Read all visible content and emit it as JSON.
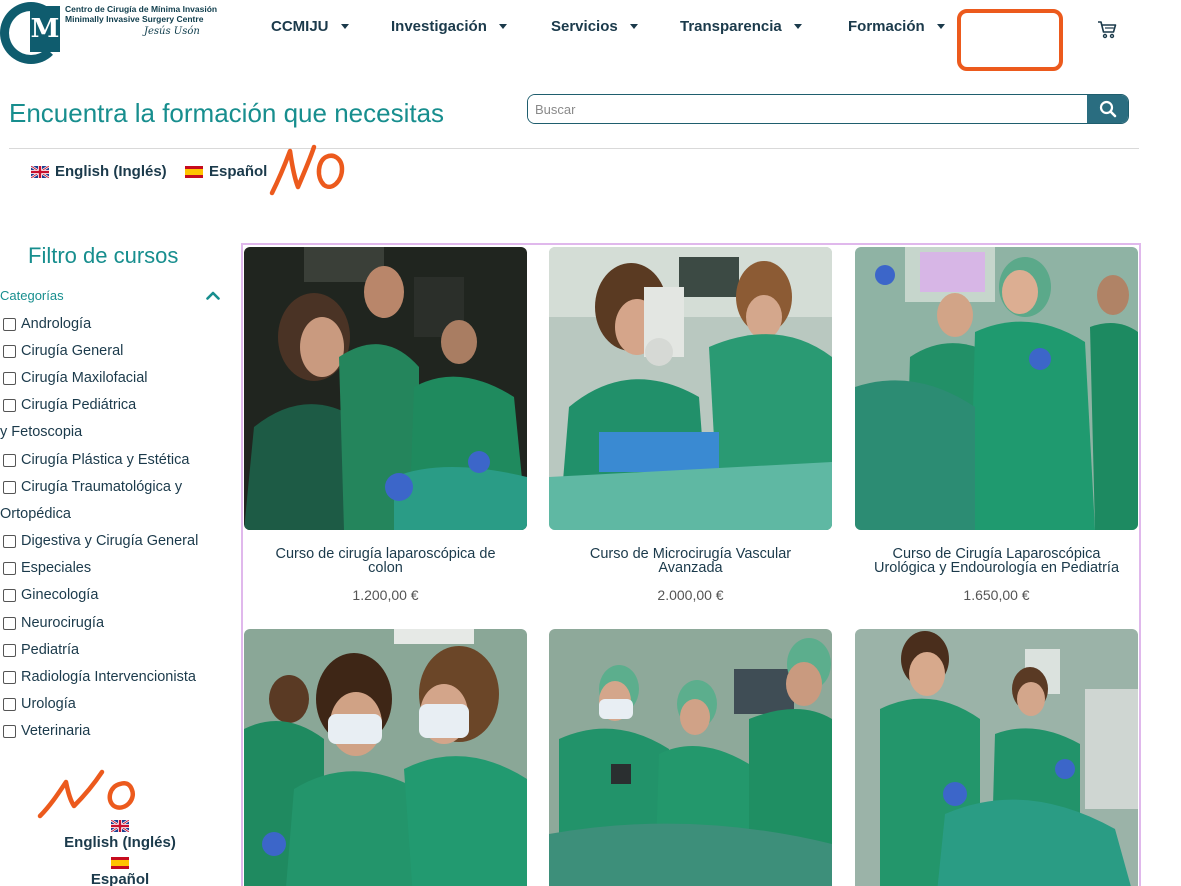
{
  "logo": {
    "line1": "Centro de Cirugía de Mínima Invasión",
    "line2": "Minimally Invasive Surgery Centre",
    "line3": "Jesús Usón",
    "mark": "M"
  },
  "nav": {
    "items": [
      {
        "label": "CCMIJU",
        "icon": "caret-down-icon"
      },
      {
        "label": "Investigación",
        "icon": "caret-down-icon"
      },
      {
        "label": "Servicios",
        "icon": "caret-down-icon"
      },
      {
        "label": "Transparencia",
        "icon": "caret-down-icon"
      },
      {
        "label": "Formación",
        "icon": "caret-down-icon"
      }
    ],
    "cart_icon": "cart-icon"
  },
  "hero": {
    "title": "Encuentra la formación que necesitas"
  },
  "search": {
    "placeholder": "Buscar",
    "value": "",
    "button_icon": "search-icon"
  },
  "languages_top": [
    {
      "label": "English (Inglés)",
      "flag": "uk-flag-icon"
    },
    {
      "label": "Español",
      "flag": "spain-flag-icon"
    }
  ],
  "annotations": {
    "top_note": "NO",
    "bottom_note": "NO",
    "color": "#ec5a1d"
  },
  "sidebar": {
    "title": "Filtro de cursos",
    "category_header": "Categorías",
    "categories": [
      "Andrología",
      "Cirugía General",
      "Cirugía Maxilofacial",
      "Cirugía Pediátrica y Fetoscopia",
      "Cirugía Plástica y Estética",
      "Cirugía Traumatológica y Ortopédica",
      "Digestiva y Cirugía General",
      "Especiales",
      "Ginecología",
      "Neurocirugía",
      "Pediatría",
      "Radiología Intervencionista",
      "Urología",
      "Veterinaria"
    ],
    "category_wraps": {
      "cat3_line1": "Cirugía Pediátrica",
      "cat3_line2": "y Fetoscopia",
      "cat5_line1": "Cirugía Traumatológica y",
      "cat5_line2": "Ortopédica"
    }
  },
  "languages_bottom": [
    {
      "label": "English (Inglés)",
      "flag": "uk-flag-icon"
    },
    {
      "label": "Español",
      "flag": "spain-flag-icon"
    }
  ],
  "products": [
    {
      "title": "Curso de cirugía laparoscópica de colon",
      "price": "1.200,00 €"
    },
    {
      "title": "Curso de Microcirugía Vascular Avanzada",
      "price": "2.000,00 €"
    },
    {
      "title": "Curso de Cirugía Laparoscópica Urológica y Endourología en Pediatría",
      "price": "1.650,00 €"
    },
    {
      "title": "",
      "price": ""
    },
    {
      "title": "",
      "price": ""
    },
    {
      "title": "",
      "price": ""
    }
  ],
  "product_title_lines": {
    "p0_l1": "Curso de cirugía laparoscópica de",
    "p0_l2": "colon",
    "p1_l1": "Curso de Microcirugía Vascular",
    "p1_l2": "Avanzada",
    "p2_l1": "Curso de Cirugía Laparoscópica",
    "p2_l2": "Urológica y Endourología en Pediatría"
  },
  "colors": {
    "teal": "#178e8e",
    "navy": "#1b3a4b",
    "scrub": "#1f8f6a",
    "border": "#e0b8ec"
  }
}
